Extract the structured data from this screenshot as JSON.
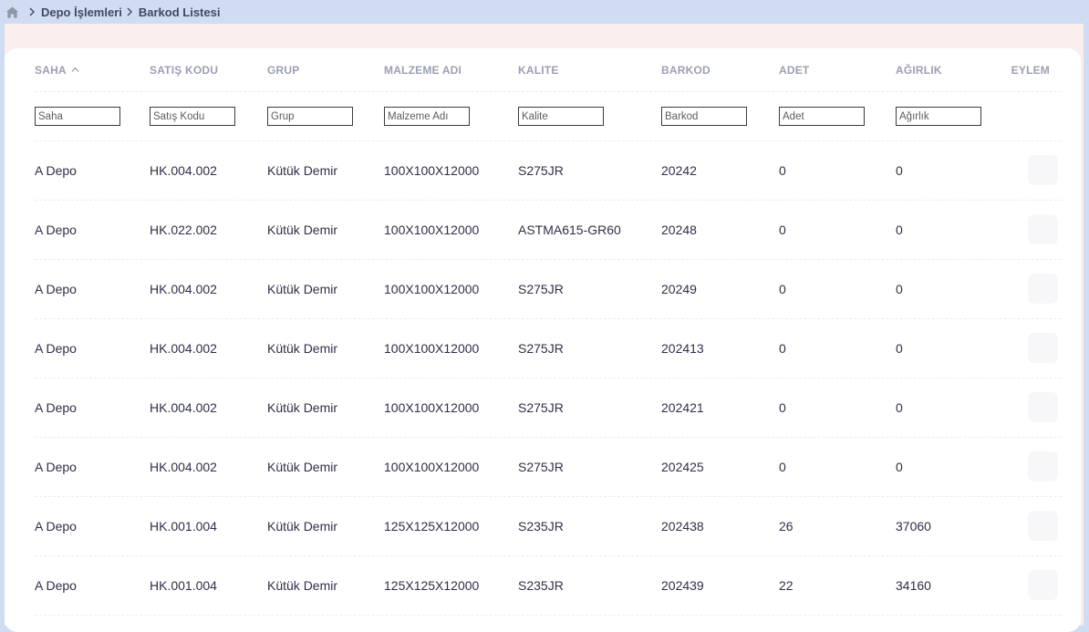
{
  "breadcrumb": {
    "items": [
      "Depo İşlemleri",
      "Barkod Listesi"
    ]
  },
  "table": {
    "columns": [
      "SAHA",
      "SATIŞ KODU",
      "GRUP",
      "MALZEME ADI",
      "KALITE",
      "BARKOD",
      "ADET",
      "AĞIRLIK",
      "EYLEM"
    ],
    "sort": {
      "column": "SAHA",
      "direction": "asc"
    },
    "filters": [
      "Saha",
      "Satış Kodu",
      "Grup",
      "Malzeme Adı",
      "Kalite",
      "Barkod",
      "Adet",
      "Ağırlık"
    ],
    "rows": [
      [
        "A Depo",
        "HK.004.002",
        "Kütük Demir",
        "100X100X12000",
        "S275JR",
        "20242",
        "0",
        "0"
      ],
      [
        "A Depo",
        "HK.022.002",
        "Kütük Demir",
        "100X100X12000",
        "ASTMA615-GR60",
        "20248",
        "0",
        "0"
      ],
      [
        "A Depo",
        "HK.004.002",
        "Kütük Demir",
        "100X100X12000",
        "S275JR",
        "20249",
        "0",
        "0"
      ],
      [
        "A Depo",
        "HK.004.002",
        "Kütük Demir",
        "100X100X12000",
        "S275JR",
        "202413",
        "0",
        "0"
      ],
      [
        "A Depo",
        "HK.004.002",
        "Kütük Demir",
        "100X100X12000",
        "S275JR",
        "202421",
        "0",
        "0"
      ],
      [
        "A Depo",
        "HK.004.002",
        "Kütük Demir",
        "100X100X12000",
        "S275JR",
        "202425",
        "0",
        "0"
      ],
      [
        "A Depo",
        "HK.001.004",
        "Kütük Demir",
        "125X125X12000",
        "S235JR",
        "202438",
        "26",
        "37060"
      ],
      [
        "A Depo",
        "HK.001.004",
        "Kütük Demir",
        "125X125X12000",
        "S235JR",
        "202439",
        "22",
        "34160"
      ]
    ]
  },
  "colors": {
    "page_background": "#cfdcf1",
    "panel_background": "#faefed",
    "card_background": "#ffffff",
    "header_text": "#9aa0b3",
    "body_text": "#2d3048"
  }
}
